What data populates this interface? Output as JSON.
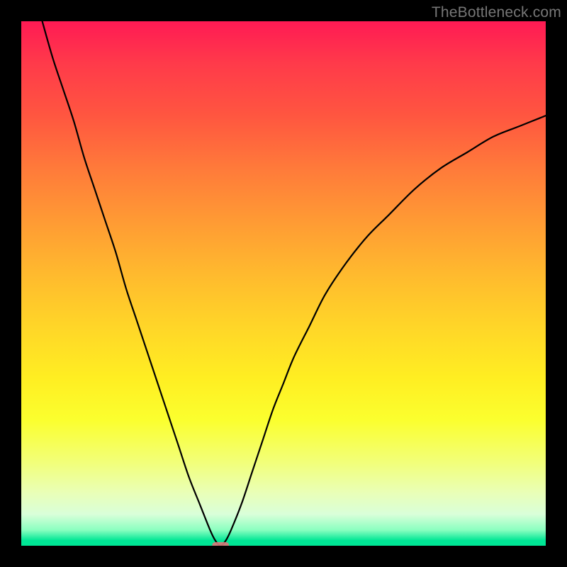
{
  "watermark": "TheBottleneck.com",
  "chart_data": {
    "type": "line",
    "title": "",
    "xlabel": "",
    "ylabel": "",
    "xlim": [
      0,
      100
    ],
    "ylim": [
      0,
      100
    ],
    "x": [
      4,
      6,
      8,
      10,
      12,
      14,
      16,
      18,
      20,
      22,
      24,
      26,
      28,
      30,
      32,
      34,
      36,
      37,
      38,
      39,
      40,
      42,
      44,
      46,
      48,
      50,
      52,
      55,
      58,
      62,
      66,
      70,
      75,
      80,
      85,
      90,
      95,
      100
    ],
    "y": [
      100,
      93,
      87,
      81,
      74,
      68,
      62,
      56,
      49,
      43,
      37,
      31,
      25,
      19,
      13,
      8,
      3,
      1,
      0,
      1,
      3,
      8,
      14,
      20,
      26,
      31,
      36,
      42,
      48,
      54,
      59,
      63,
      68,
      72,
      75,
      78,
      80,
      82
    ],
    "minimum_x": 38,
    "marker": {
      "x": 38,
      "y": 0,
      "color": "#d77a7a"
    }
  }
}
